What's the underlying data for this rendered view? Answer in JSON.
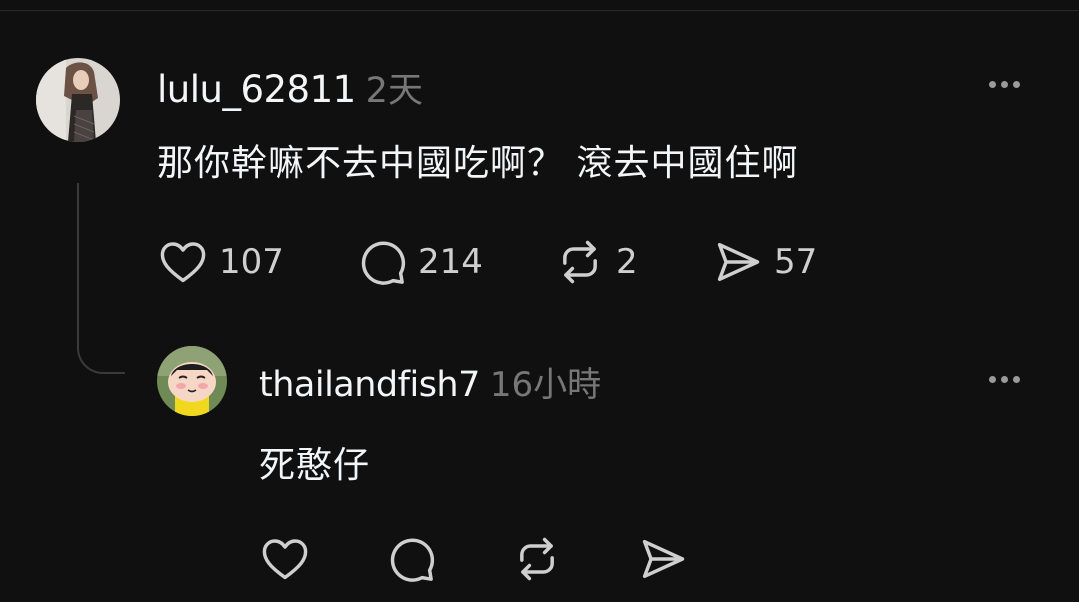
{
  "thread": {
    "parent": {
      "username": "lulu_62811",
      "time": "2天",
      "text": "那你幹嘛不去中國吃啊？ 滾去中國住啊",
      "likes": "107",
      "replies": "214",
      "reposts": "2",
      "shares": "57"
    },
    "reply": {
      "username": "thailandfish7",
      "time": "16小時",
      "text": "死憨仔"
    }
  },
  "icons": {
    "like": "heart-icon",
    "reply": "comment-bubble-icon",
    "repost": "repost-icon",
    "share": "send-icon",
    "more": "more-dots-icon"
  },
  "colors": {
    "background": "#101010",
    "text": "#f3f5f7",
    "muted": "#777777"
  }
}
